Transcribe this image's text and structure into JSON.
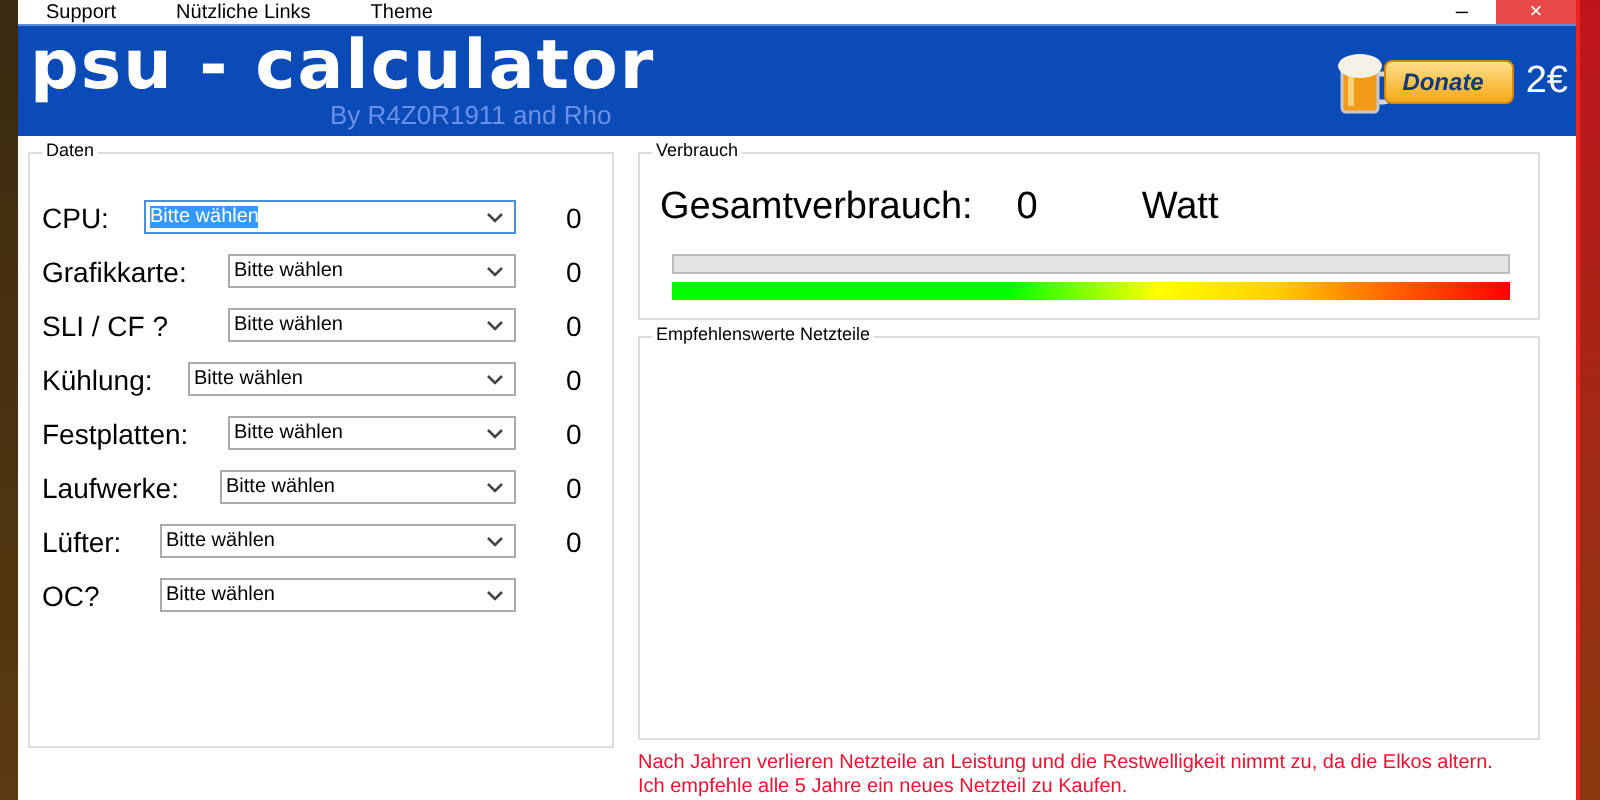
{
  "menu": [
    "Support",
    "Nützliche Links",
    "Theme"
  ],
  "window_controls": {
    "minimize": "–",
    "close": "×"
  },
  "banner": {
    "title": "psu - calculator",
    "subtitle": "By R4Z0R1911 and Rho",
    "donate": "Donate",
    "amount": "2€"
  },
  "daten": {
    "title": "Daten",
    "rows": [
      {
        "label": "CPU:",
        "value": "Bitte wählen",
        "focused": true,
        "reading": "0"
      },
      {
        "label": "Grafikkarte:",
        "value": "Bitte wählen",
        "focused": false,
        "reading": "0"
      },
      {
        "label": "SLI / CF ?",
        "value": "Bitte wählen",
        "focused": false,
        "reading": "0"
      },
      {
        "label": "Kühlung:",
        "value": "Bitte wählen",
        "focused": false,
        "reading": "0"
      },
      {
        "label": "Festplatten:",
        "value": "Bitte wählen",
        "focused": false,
        "reading": "0"
      },
      {
        "label": "Laufwerke:",
        "value": "Bitte wählen",
        "focused": false,
        "reading": "0"
      },
      {
        "label": "Lüfter:",
        "value": "Bitte wählen",
        "focused": false,
        "reading": "0"
      },
      {
        "label": "OC?",
        "value": "Bitte wählen",
        "focused": false
      }
    ]
  },
  "verbrauch": {
    "title": "Verbrauch",
    "label": "Gesamtverbrauch:",
    "value": "0",
    "unit": "Watt",
    "level": 0
  },
  "netzteile": {
    "title": "Empfehlenswerte Netzteile"
  },
  "notes": [
    "Nach Jahren verlieren Netzteile an Leistung und die Restwelligkeit nimmt zu, da die Elkos altern.",
    "Ich empfehle alle 5 Jahre ein neues Netzteil zu Kaufen."
  ]
}
